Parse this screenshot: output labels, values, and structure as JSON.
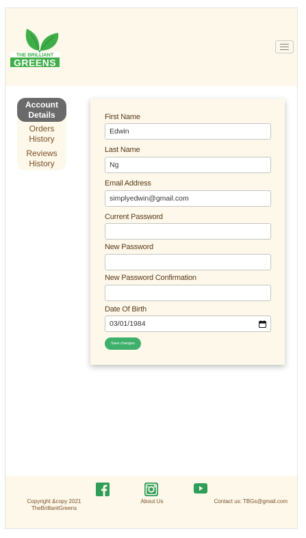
{
  "brand": {
    "logo_line1": "THE BRILLIANT",
    "logo_line2": "GREENS",
    "accent_green": "#3fb06b",
    "cream": "#fdf8ea"
  },
  "header": {
    "menu_icon": "hamburger-icon"
  },
  "sidebar": {
    "items": [
      {
        "line1": "Account",
        "line2": "Details",
        "active": true
      },
      {
        "line1": "Orders",
        "line2": "History",
        "active": false
      },
      {
        "line1": "Reviews",
        "line2": "History",
        "active": false
      }
    ]
  },
  "form": {
    "first_name": {
      "label": "First Name",
      "value": "Edwin"
    },
    "last_name": {
      "label": "Last Name",
      "value": "Ng"
    },
    "email": {
      "label": "Email Address",
      "value": "simplyedwin@gmail.com"
    },
    "current_password": {
      "label": "Current Password",
      "value": ""
    },
    "new_password": {
      "label": "New Password",
      "value": ""
    },
    "new_password_confirmation": {
      "label": "New Password Confirmation",
      "value": ""
    },
    "date_of_birth": {
      "label": "Date Of Birth",
      "value": "03/01/1984",
      "icon": "calendar-icon"
    },
    "save_label": "Save changes"
  },
  "footer": {
    "copyright_line1": "Copyright &copy 2021",
    "copyright_line2": "TheBrilliantGreens",
    "about_label": "About Us",
    "contact": "Contact us: TBGs@gmail.com",
    "icons": [
      "facebook-icon",
      "instagram-icon",
      "youtube-icon"
    ]
  }
}
